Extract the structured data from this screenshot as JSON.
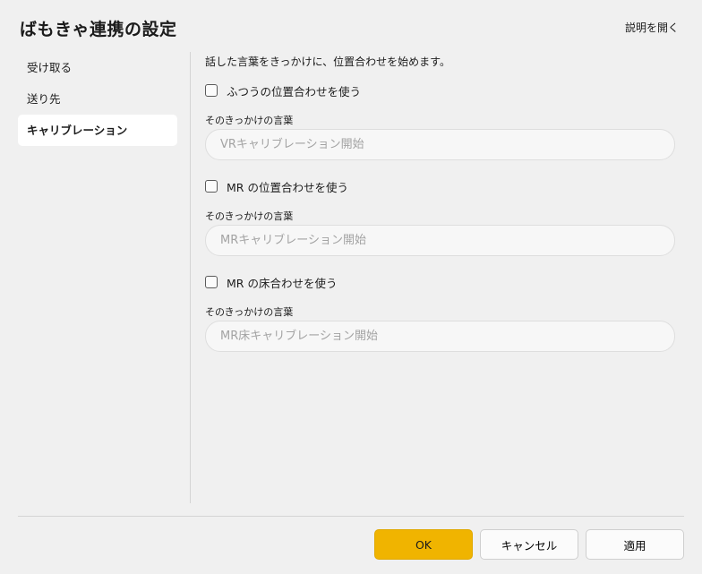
{
  "window": {
    "title": "ばもきゃ連携の設定",
    "help_link": "説明を開く"
  },
  "sidebar": {
    "items": [
      {
        "label": "受け取る",
        "selected": false
      },
      {
        "label": "送り先",
        "selected": false
      },
      {
        "label": "キャリブレーション",
        "selected": true
      }
    ]
  },
  "main": {
    "description": "話した言葉をきっかけに、位置合わせを始めます。",
    "groups": [
      {
        "checkbox_label": "ふつうの位置合わせを使う",
        "checked": false,
        "field_label": "そのきっかけの言葉",
        "value": "",
        "placeholder": "VRキャリブレーション開始"
      },
      {
        "checkbox_label": "MR の位置合わせを使う",
        "checked": false,
        "field_label": "そのきっかけの言葉",
        "value": "",
        "placeholder": "MRキャリブレーション開始"
      },
      {
        "checkbox_label": "MR の床合わせを使う",
        "checked": false,
        "field_label": "そのきっかけの言葉",
        "value": "",
        "placeholder": "MR床キャリブレーション開始"
      }
    ]
  },
  "footer": {
    "ok_label": "OK",
    "cancel_label": "キャンセル",
    "apply_label": "適用"
  },
  "colors": {
    "accent": "#f0b400",
    "background": "#f0f0f0",
    "selected_item": "#ffffff"
  }
}
